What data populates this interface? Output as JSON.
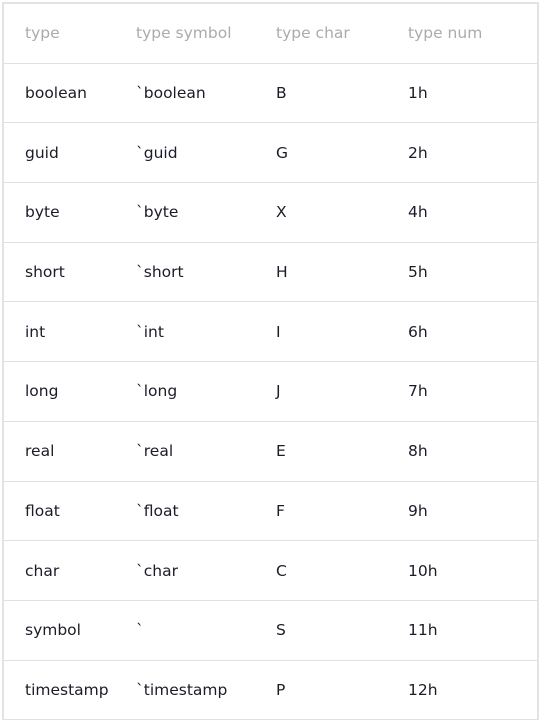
{
  "table": {
    "headers": [
      "type",
      "type symbol",
      "type char",
      "type num"
    ],
    "rows": [
      [
        "boolean",
        "`boolean",
        "B",
        "1h"
      ],
      [
        "guid",
        "`guid",
        "G",
        "2h"
      ],
      [
        "byte",
        "`byte",
        "X",
        "4h"
      ],
      [
        "short",
        "`short",
        "H",
        "5h"
      ],
      [
        "int",
        "`int",
        "I",
        "6h"
      ],
      [
        "long",
        "`long",
        "J",
        "7h"
      ],
      [
        "real",
        "`real",
        "E",
        "8h"
      ],
      [
        "float",
        "`float",
        "F",
        "9h"
      ],
      [
        "char",
        "`char",
        "C",
        "10h"
      ],
      [
        "symbol",
        "`",
        "S",
        "11h"
      ],
      [
        "timestamp",
        "`timestamp",
        "P",
        "12h"
      ]
    ]
  }
}
